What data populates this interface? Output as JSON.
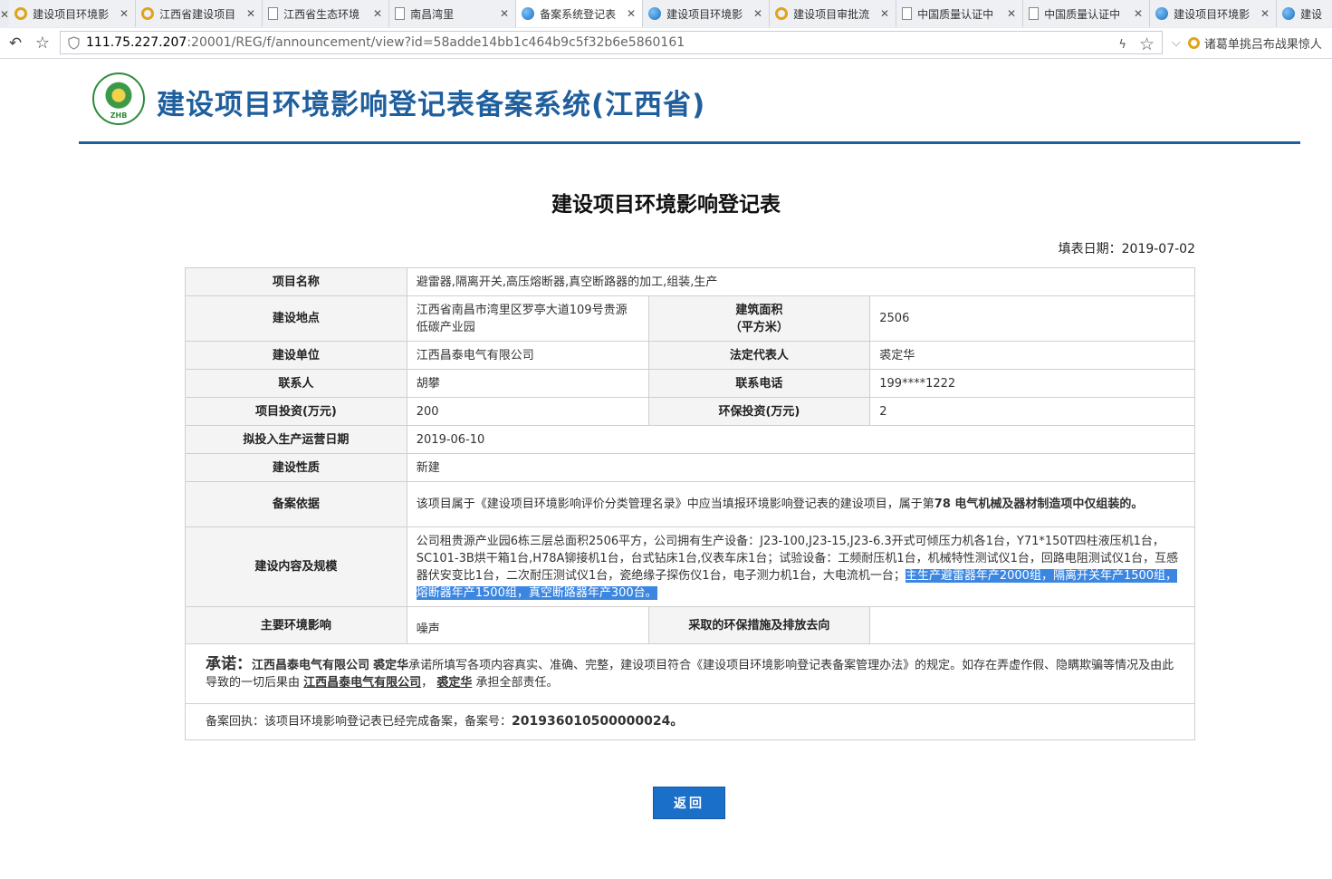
{
  "browser": {
    "tabs": [
      {
        "label": "建设项目环境影",
        "icon": "circle-icon",
        "active": false
      },
      {
        "label": "江西省建设项目",
        "icon": "circle-icon",
        "active": false
      },
      {
        "label": "江西省生态环境",
        "icon": "document-icon",
        "active": false
      },
      {
        "label": "南昌湾里",
        "icon": "document-icon",
        "active": false
      },
      {
        "label": "备案系统登记表",
        "icon": "globe-icon",
        "active": true
      },
      {
        "label": "建设项目环境影",
        "icon": "globe-icon",
        "active": false
      },
      {
        "label": "建设项目审批流",
        "icon": "circle-icon",
        "active": false
      },
      {
        "label": "中国质量认证中",
        "icon": "document-icon",
        "active": false
      },
      {
        "label": "中国质量认证中",
        "icon": "document-icon",
        "active": false
      },
      {
        "label": "建设项目环境影",
        "icon": "globe-icon",
        "active": false
      },
      {
        "label": "建设",
        "icon": "globe-icon",
        "active": false
      }
    ],
    "url_host": "111.75.227.207",
    "url_rest": ":20001/REG/f/announcement/view?id=58adde14bb1c464b9c5f32b6e5860161",
    "search_text": "诸葛单挑吕布战果惊人"
  },
  "header": {
    "logo_text": "ZHB",
    "title": "建设项目环境影响登记表备案系统(江西省)"
  },
  "form": {
    "title": "建设项目环境影响登记表",
    "fill_date": "填表日期：2019-07-02",
    "labels": {
      "project_name": "项目名称",
      "location": "建设地点",
      "area": "建筑面积",
      "area_unit": "（平方米）",
      "unit": "建设单位",
      "legal_rep": "法定代表人",
      "contact": "联系人",
      "phone": "联系电话",
      "investment": "项目投资(万元)",
      "env_investment": "环保投资(万元)",
      "start_date": "拟投入生产运营日期",
      "nature": "建设性质",
      "basis": "备案依据",
      "content": "建设内容及规模",
      "impact": "主要环境影响",
      "measures": "采取的环保措施及排放去向"
    },
    "values": {
      "project_name": "避雷器,隔离开关,高压熔断器,真空断路器的加工,组装,生产",
      "location": "江西省南昌市湾里区罗亭大道109号贵源低碳产业园",
      "area": "2506",
      "unit": "江西昌泰电气有限公司",
      "legal_rep": "裘定华",
      "contact": "胡攀",
      "phone": "199****1222",
      "investment": "200",
      "env_investment": "2",
      "start_date": "2019-06-10",
      "nature": "新建",
      "basis_pre": "该项目属于《建设项目环境影响评价分类管理名录》中应当填报环境影响登记表的建设项目，属于第",
      "basis_bold": "78 电气机械及器材制造项中仅组装的。",
      "content_plain": "公司租贵源产业园6栋三层总面积2506平方，公司拥有生产设备：J23-100,J23-15,J23-6.3开式可倾压力机各1台，Y71*150T四柱液压机1台，SC101-3B烘干箱1台,H78A铆接机1台，台式钻床1台,仪表车床1台；试验设备：工频耐压机1台，机械特性测试仪1台，回路电阻测试仪1台，互感器伏安变比1台，二次耐压测试仪1台，瓷绝缘子探伤仪1台，电子测力机1台，大电流机一台；",
      "content_highlight": "主生产避雷器年产2000组，隔离开关年产1500组，熔断器年产1500组，真空断路器年产300台。",
      "impact": "噪声",
      "measures": ""
    },
    "promise": {
      "lead": "承诺：",
      "company": "江西昌泰电气有限公司",
      "person": "裘定华",
      "text1": "承诺所填写各项内容真实、准确、完整，建设项目符合《建设项目环境影响登记表备案管理办法》的规定。如存在弄虚作假、隐瞒欺骗等情况及由此导致的一切后果由",
      "company2": "江西昌泰电气有限公司",
      "sep": "，",
      "person2": "裘定华",
      "text2": "承担全部责任。"
    },
    "receipt_pre": "备案回执：该项目环境影响登记表已经完成备案，备案号：",
    "receipt_no": "201936010500000024。"
  },
  "back_label": "返回"
}
